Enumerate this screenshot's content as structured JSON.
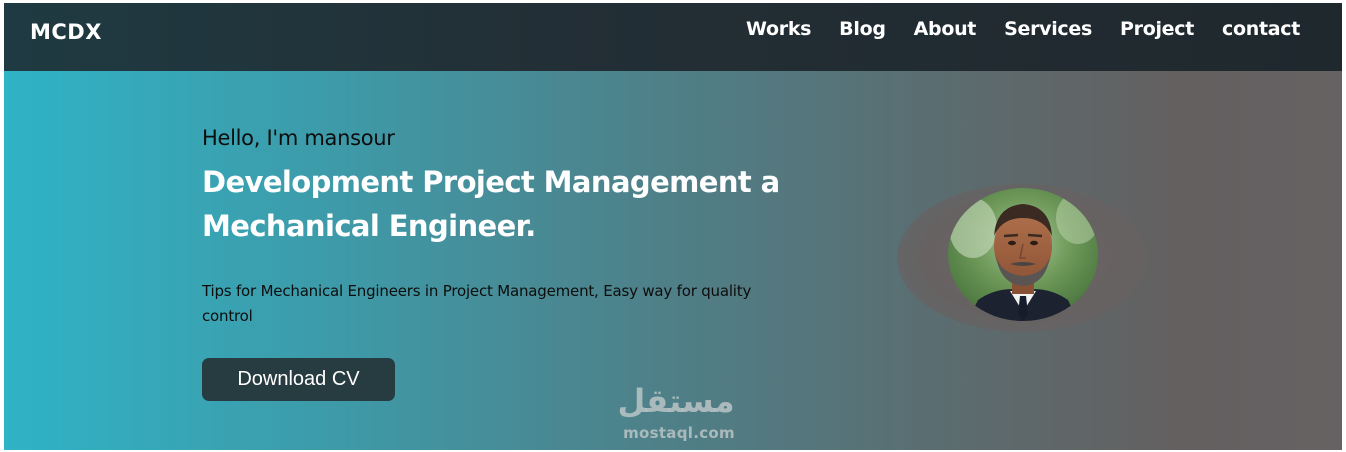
{
  "navbar": {
    "brand": "MCDX",
    "links": [
      "Works",
      "Blog",
      "About",
      "Services",
      "Project",
      "contact"
    ]
  },
  "hero": {
    "greeting": "Hello, I'm mansour",
    "headline": "Development Project Management a Mechanical Engineer.",
    "tagline": "Tips for Mechanical Engineers in Project Management, Easy way for quality control",
    "cv_button": "Download CV"
  },
  "watermark": {
    "logo_text": "مستقل",
    "url": "mostaql.com"
  },
  "colors": {
    "nav_bg": "#1f2c32",
    "hero_gradient_start": "#2fb3c6",
    "hero_gradient_end": "#666263",
    "button_bg": "#273c40"
  }
}
